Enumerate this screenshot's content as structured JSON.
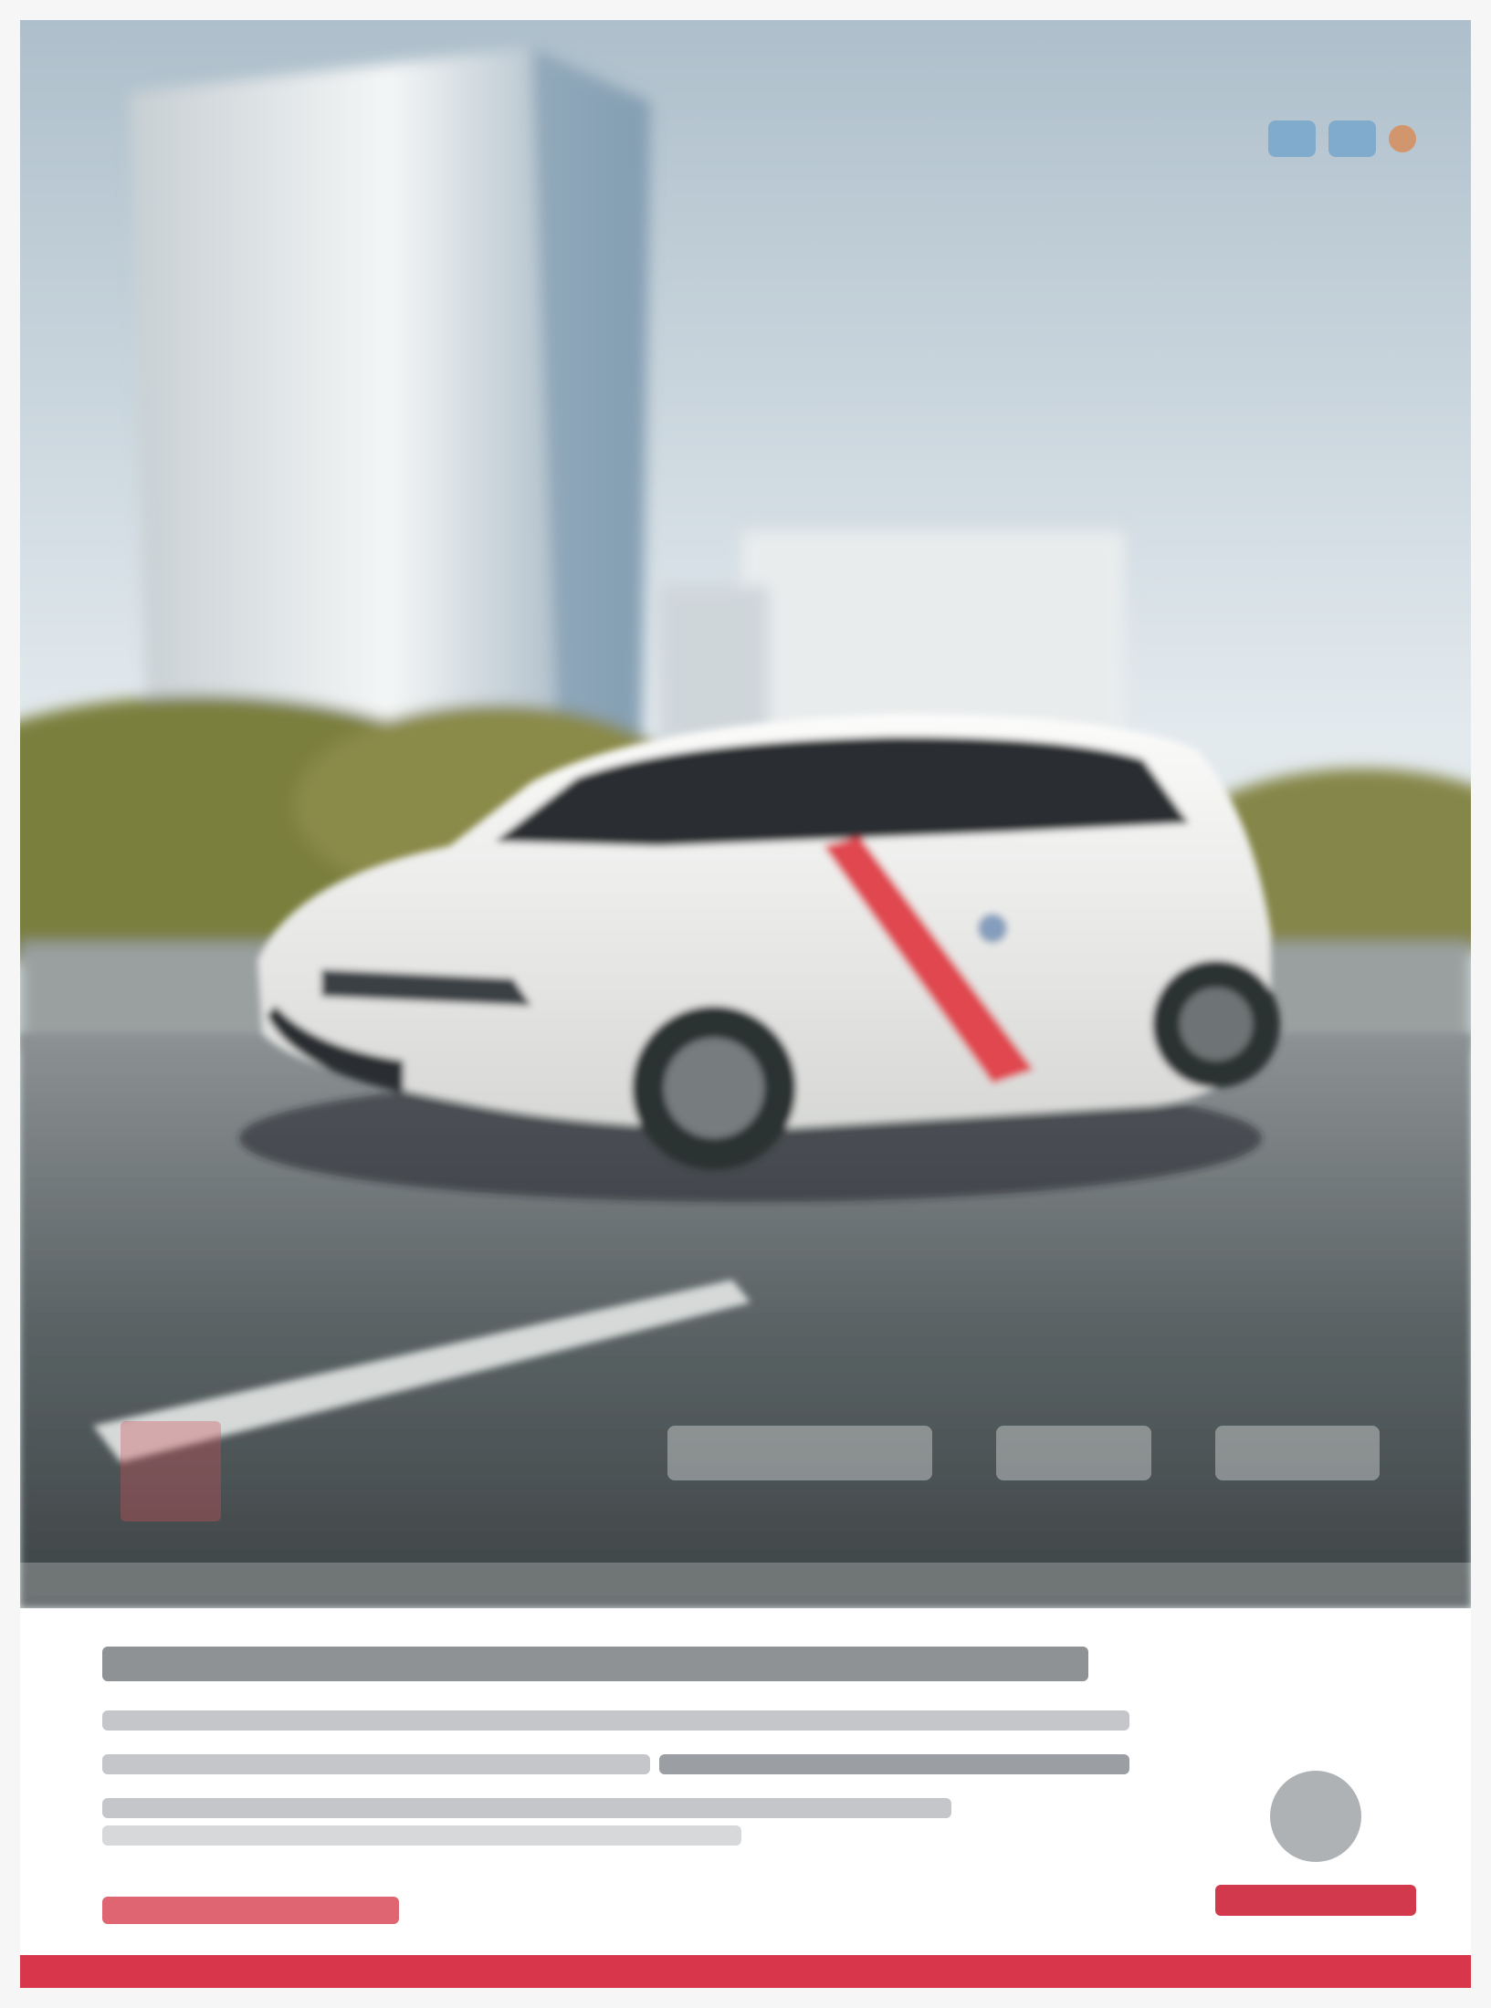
{
  "ad": {
    "headline_line_1": "",
    "headline_line_2": "",
    "body_heading": "",
    "body_text": "",
    "website": "",
    "brand": ""
  },
  "colors": {
    "sky_top": "#b9c9d4",
    "sky_bottom": "#e8eef1",
    "asphalt": "#5f6669",
    "car_body": "#f2f2f0",
    "taxi_stripe": "#e0474f",
    "brand_red": "#d8374b",
    "page_bg": "#ffffff"
  },
  "icons": {
    "top_right_logos": [
      "partner-logo",
      "partner-logo",
      "partner-badge"
    ],
    "brand_logo": "double-chevron-emblem"
  }
}
